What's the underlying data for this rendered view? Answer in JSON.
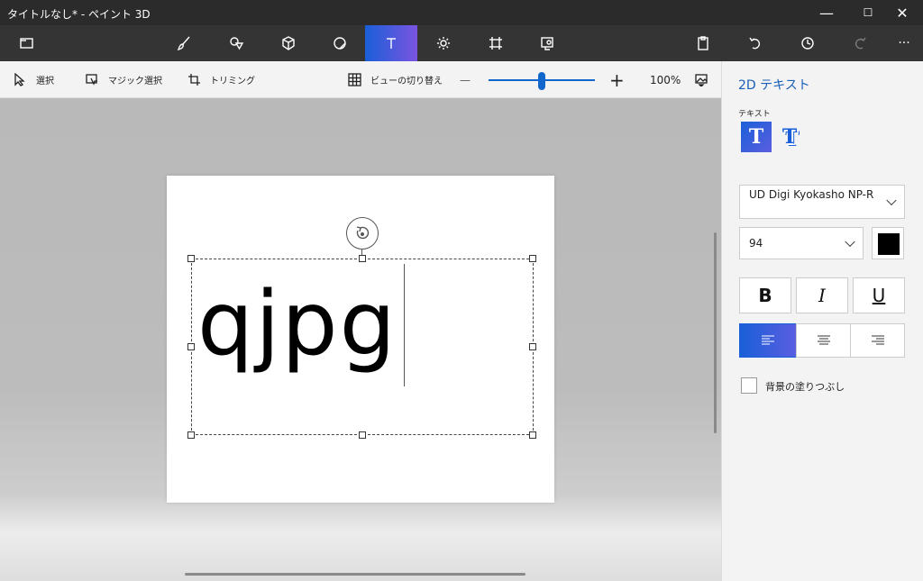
{
  "window": {
    "title": "タイトルなし* - ペイント 3D",
    "minimize_glyph": "—",
    "maximize_glyph": "☐",
    "close_glyph": "✕"
  },
  "toolbar": {
    "tools": [
      "menu-icon",
      "brush-icon",
      "2d-shapes-icon",
      "3d-shapes-icon",
      "stickers-icon",
      "text-icon",
      "effects-icon",
      "canvas-icon",
      "3d-library-icon"
    ],
    "active_tool": "text-icon",
    "actions": [
      "paste-icon",
      "undo-icon",
      "history-icon",
      "redo-icon",
      "more-icon"
    ],
    "more_glyph": "···"
  },
  "commands": {
    "select": "選択",
    "magic_select": "マジック選択",
    "crop": "トリミング",
    "view_toggle": "ビューの切り替え",
    "zoom_out": "—",
    "zoom_in": "+",
    "zoom_level": "100%",
    "zoom_fraction": 0.5
  },
  "canvas": {
    "text": "qjpg"
  },
  "panel": {
    "title": "2D テキスト",
    "text_label": "テキスト",
    "text_type_2d": "T",
    "text_type_3d": "T",
    "font": "UD Digi Kyokasho NP-R",
    "font_size": "94",
    "text_color": "#000000",
    "bold": "B",
    "italic": "I",
    "underline": "U",
    "alignment_selected": "left",
    "fill_background_label": "背景の塗りつぶし",
    "fill_background_checked": false
  },
  "colors": {
    "accent": "#1a5fd8",
    "accent2": "#7a54e0",
    "titlebar": "#2b2b2b",
    "toolbar": "#343434"
  }
}
